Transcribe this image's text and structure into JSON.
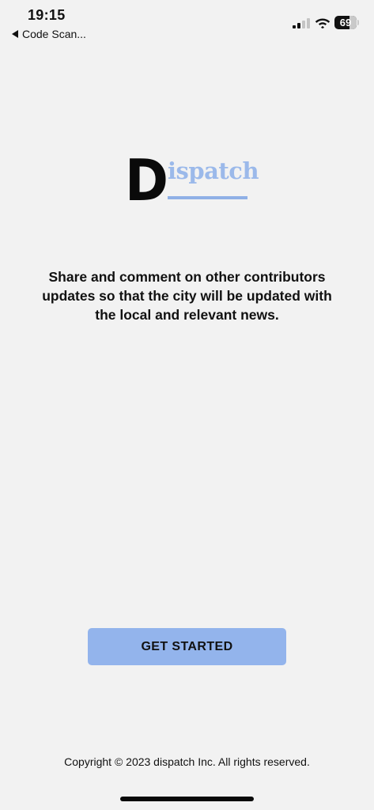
{
  "status_bar": {
    "time": "19:15",
    "back_app_label": "Code Scan...",
    "battery_level": "69",
    "battery_fraction": 0.69,
    "signal_bars_active": 2,
    "signal_bars_total": 4
  },
  "logo": {
    "initial": "D",
    "rest": "ispatch",
    "colors": {
      "initial": "#0a0a0a",
      "wordmark": "#9bb9ea"
    }
  },
  "tagline": "Share and comment on other contributors updates so that the city will be updated with the local and relevant news.",
  "cta": {
    "label": "GET STARTED",
    "color": "#93b4ec"
  },
  "footer": {
    "copyright": "Copyright © 2023 dispatch Inc. All rights reserved."
  },
  "icons": {
    "back": "back-arrow-icon",
    "signal": "cellular-signal-icon",
    "wifi": "wifi-icon",
    "battery": "battery-icon"
  }
}
